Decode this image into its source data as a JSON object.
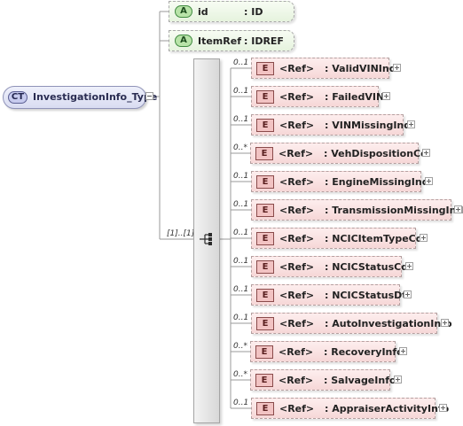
{
  "complex_type": {
    "badge": "CT",
    "name": "InvestigationInfo_Type"
  },
  "attributes": [
    {
      "badge": "A",
      "name": "id",
      "type": ": ID"
    },
    {
      "badge": "A",
      "name": "ItemRef",
      "type": ": IDREF"
    }
  ],
  "sequence": {
    "multiplicity": "[1]..[1]"
  },
  "elements": [
    {
      "multiplicity": "0..1",
      "badge": "E",
      "ref": "<Ref>",
      "name": ": ValidVINInd"
    },
    {
      "multiplicity": "0..1",
      "badge": "E",
      "ref": "<Ref>",
      "name": ": FailedVIN"
    },
    {
      "multiplicity": "0..1",
      "badge": "E",
      "ref": "<Ref>",
      "name": ": VINMissingInd"
    },
    {
      "multiplicity": "0..*",
      "badge": "E",
      "ref": "<Ref>",
      "name": ": VehDispositionCd"
    },
    {
      "multiplicity": "0..1",
      "badge": "E",
      "ref": "<Ref>",
      "name": ": EngineMissingInd"
    },
    {
      "multiplicity": "0..1",
      "badge": "E",
      "ref": "<Ref>",
      "name": ": TransmissionMissingInd"
    },
    {
      "multiplicity": "0..1",
      "badge": "E",
      "ref": "<Ref>",
      "name": ": NCICItemTypeCd"
    },
    {
      "multiplicity": "0..1",
      "badge": "E",
      "ref": "<Ref>",
      "name": ": NCICStatusCd"
    },
    {
      "multiplicity": "0..1",
      "badge": "E",
      "ref": "<Ref>",
      "name": ": NCICStatusDt"
    },
    {
      "multiplicity": "0..1",
      "badge": "E",
      "ref": "<Ref>",
      "name": ": AutoInvestigationInfo"
    },
    {
      "multiplicity": "0..*",
      "badge": "E",
      "ref": "<Ref>",
      "name": ": RecoveryInfo"
    },
    {
      "multiplicity": "0..*",
      "badge": "E",
      "ref": "<Ref>",
      "name": ": SalvageInfo"
    },
    {
      "multiplicity": "0..1",
      "badge": "E",
      "ref": "<Ref>",
      "name": ": AppraiserActivityInfo"
    }
  ]
}
